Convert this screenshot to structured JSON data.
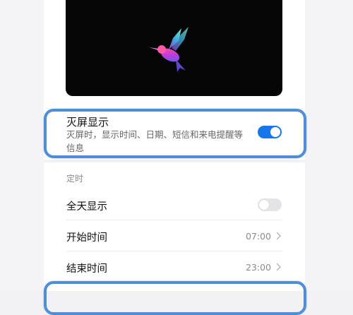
{
  "accent_color": "#1677e8",
  "highlight_color": "#4f8ed3",
  "preview": {
    "icon": "hummingbird-icon"
  },
  "aod": {
    "title": "灭屏显示",
    "description": "灭屏时，显示时间、日期、短信和来电提醒等信息",
    "enabled": true
  },
  "timer": {
    "section_label": "定时",
    "all_day": {
      "label": "全天显示",
      "enabled": false
    },
    "start": {
      "label": "开始时间",
      "value": "07:00"
    },
    "end": {
      "label": "结束时间",
      "value": "23:00"
    }
  }
}
